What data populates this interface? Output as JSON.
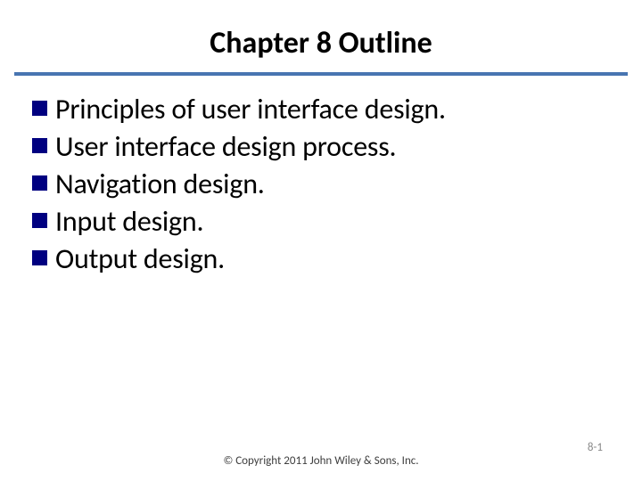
{
  "title": "Chapter 8 Outline",
  "bullets": [
    "Principles of user interface design.",
    "User interface design process.",
    "Navigation design.",
    "Input design.",
    "Output design."
  ],
  "footer": {
    "copyright": "© Copyright 2011 John Wiley & Sons, Inc.",
    "page": "8-1"
  }
}
